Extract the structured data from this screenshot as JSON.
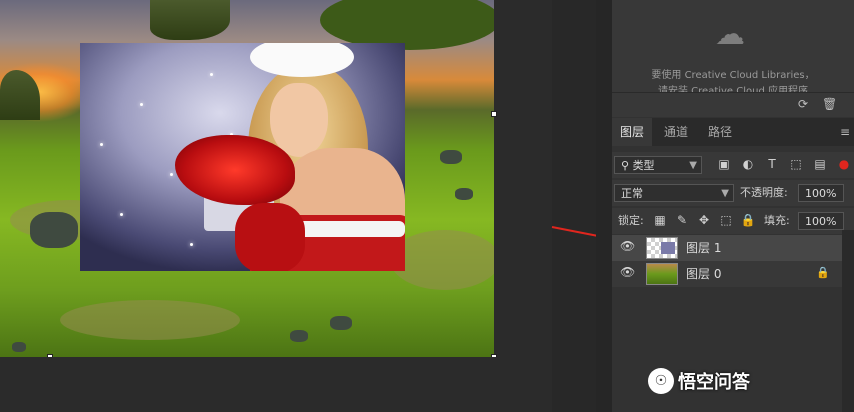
{
  "libraries": {
    "line1": "要使用 Creative Cloud Libraries，",
    "line2": "请安装 Creative Cloud 应用程序",
    "icon": "creative-cloud-icon"
  },
  "tabs": [
    {
      "label": "图层",
      "active": true
    },
    {
      "label": "通道",
      "active": false
    },
    {
      "label": "路径",
      "active": false
    }
  ],
  "filter": {
    "kind_label": "类型"
  },
  "blend": {
    "mode": "正常",
    "opacity_label": "不透明度:",
    "opacity_value": "100%"
  },
  "lock": {
    "label": "锁定:",
    "fill_label": "填充:",
    "fill_value": "100%"
  },
  "layers": [
    {
      "name": "图层 1",
      "visible": true,
      "selected": true,
      "locked": false
    },
    {
      "name": "图层 0",
      "visible": true,
      "selected": false,
      "locked": true
    }
  ],
  "watermark": {
    "text": "悟空问答"
  },
  "colors": {
    "accent_arrow": "#e0261e",
    "panel_bg": "#383838",
    "selected_layer": "#474747"
  }
}
